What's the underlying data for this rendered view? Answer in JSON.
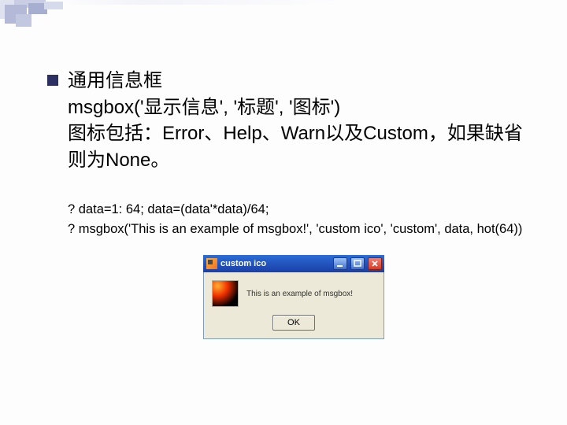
{
  "slide": {
    "bullet": {
      "line1": "通用信息框",
      "line2": "msgbox('显示信息', '标题', '图标')",
      "line3": "图标包括：Error、Help、Warn以及Custom，如果缺省则为None。"
    },
    "code": {
      "line1": "? data=1: 64; data=(data'*data)/64;",
      "line2": "? msgbox('This is an example of msgbox!', 'custom ico', 'custom', data, hot(64))"
    }
  },
  "dialog": {
    "title": "custom ico",
    "message": "This is an example of msgbox!",
    "ok_label": "OK",
    "window_buttons": {
      "minimize": "minimize",
      "maximize": "maximize",
      "close": "close"
    },
    "icon_name": "custom-hot-colormap"
  },
  "colors": {
    "bullet": "#2b2f62",
    "titlebar": "#2556c0",
    "dialog_bg": "#ece9d8"
  }
}
